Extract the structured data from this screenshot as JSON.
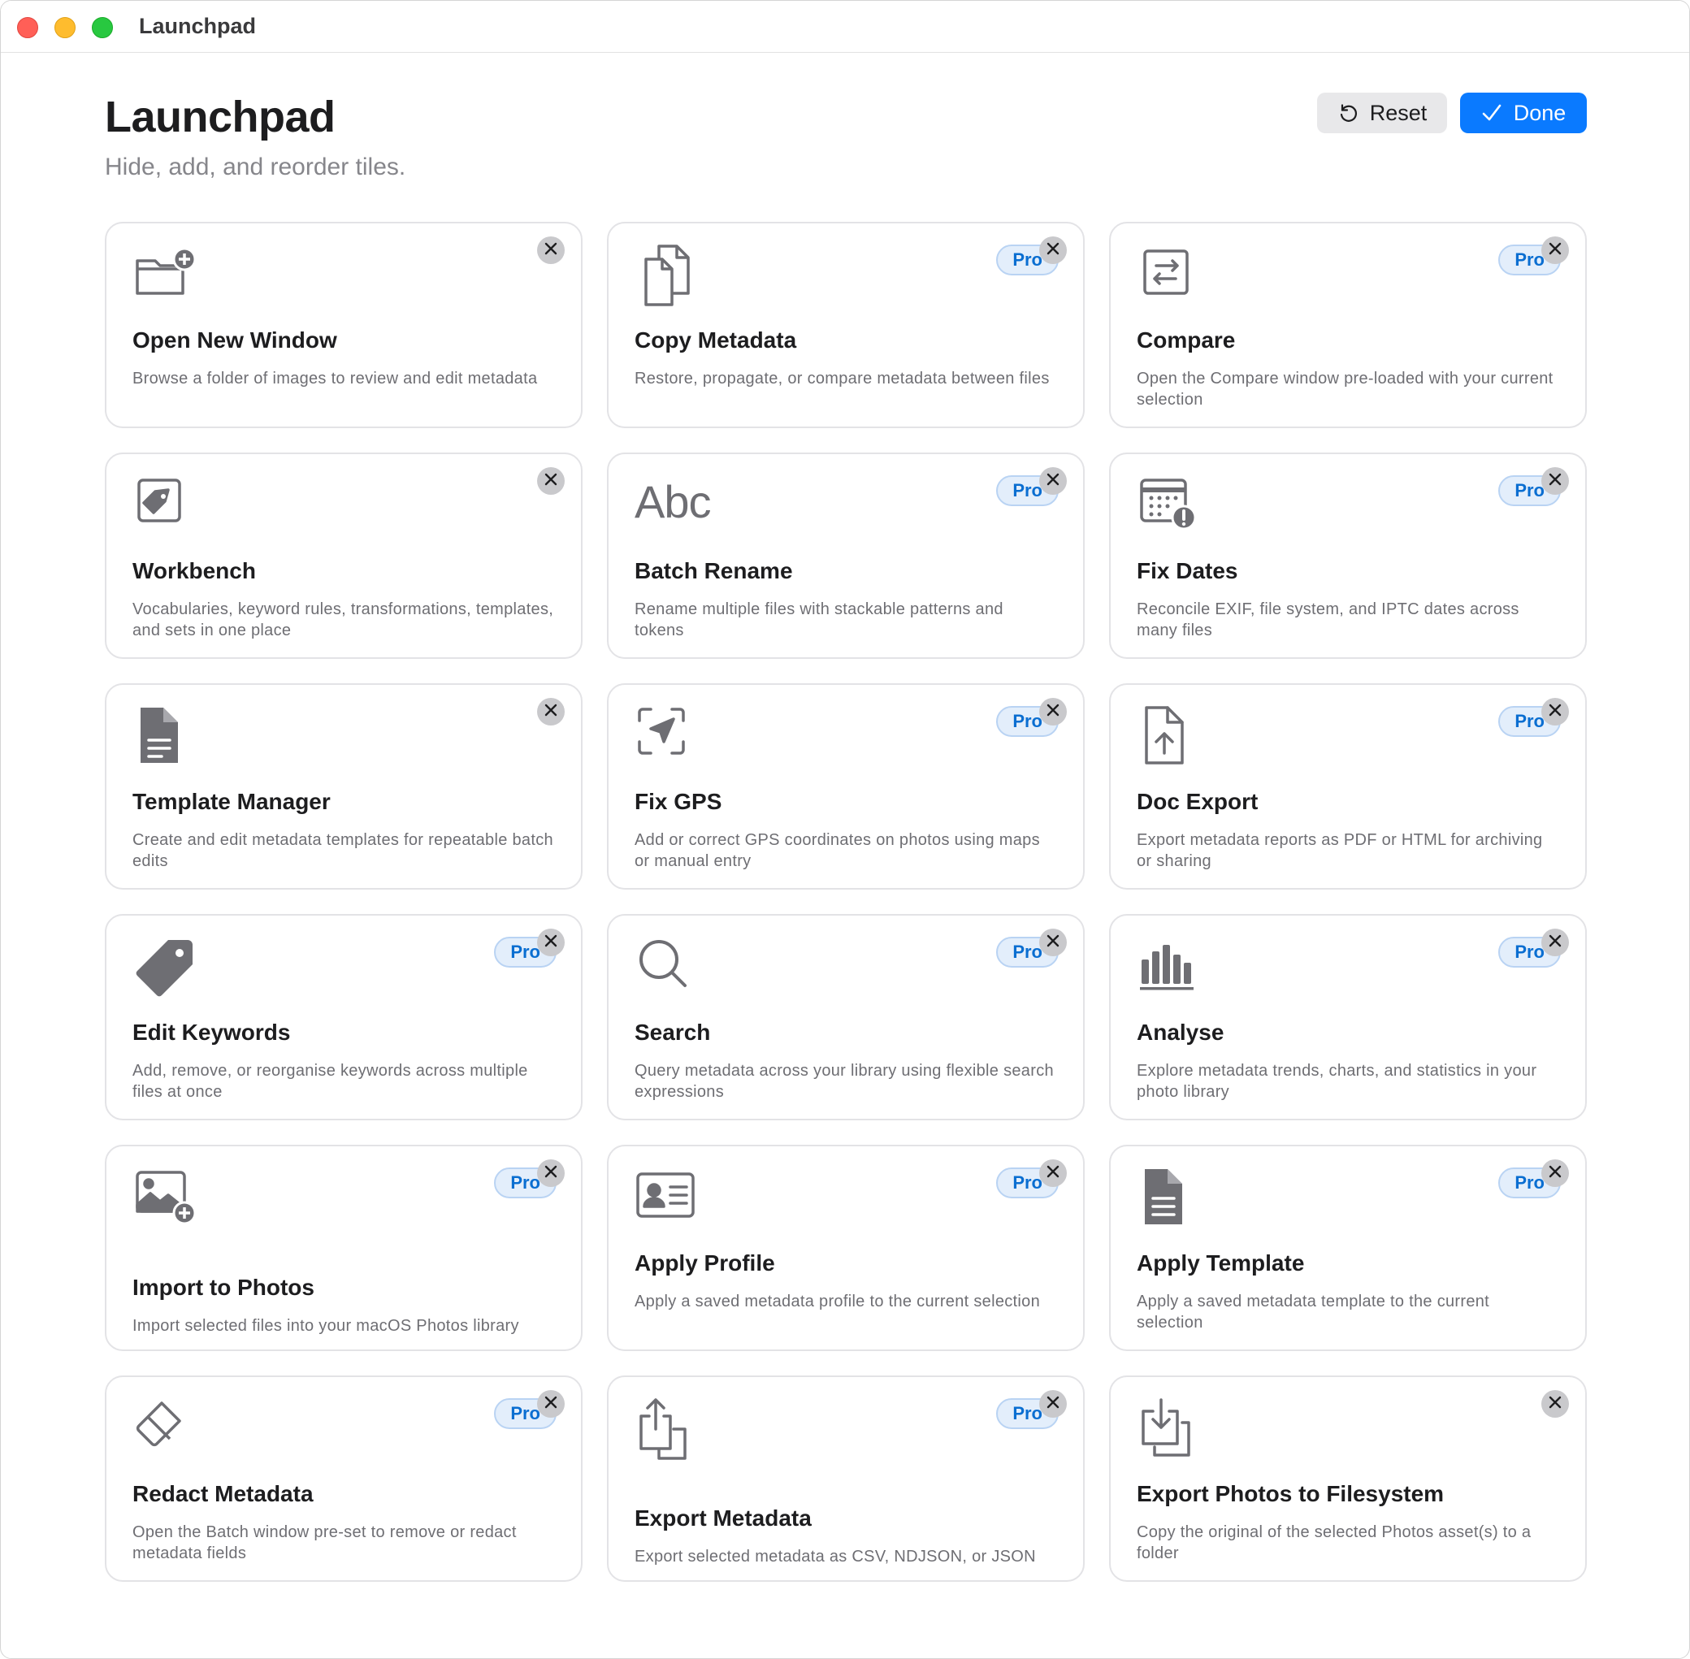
{
  "window": {
    "title": "Launchpad"
  },
  "header": {
    "title": "Launchpad",
    "subtitle": "Hide, add, and reorder tiles.",
    "reset_label": "Reset",
    "done_label": "Done"
  },
  "colors": {
    "accent": "#0a7aff",
    "pro_badge_text": "#0a6ed1",
    "icon": "#6e6e73"
  },
  "tiles": [
    {
      "title": "Open New Window",
      "desc": "Browse a folder of images to review and edit metadata",
      "pro": false,
      "icon": "folder-add-icon"
    },
    {
      "title": "Copy Metadata",
      "desc": "Restore, propagate, or compare metadata between files",
      "pro": true,
      "pro_label": "Pro",
      "icon": "copy-documents-icon"
    },
    {
      "title": "Compare",
      "desc": "Open the Compare window pre-loaded with your current selection",
      "pro": true,
      "pro_label": "Pro",
      "icon": "compare-arrows-icon"
    },
    {
      "title": "Workbench",
      "desc": "Vocabularies, keyword rules, transformations, templates, and sets in one place",
      "pro": false,
      "icon": "tag-square-icon"
    },
    {
      "title": "Batch Rename",
      "desc": "Rename multiple files with stackable patterns and tokens",
      "pro": true,
      "pro_label": "Pro",
      "icon": "abc-text-icon",
      "icon_text": "Abc"
    },
    {
      "title": "Fix Dates",
      "desc": "Reconcile EXIF, file system, and IPTC dates across many files",
      "pro": true,
      "pro_label": "Pro",
      "icon": "calendar-alert-icon"
    },
    {
      "title": "Template Manager",
      "desc": "Create and edit metadata templates for repeatable batch edits",
      "pro": false,
      "icon": "document-icon"
    },
    {
      "title": "Fix GPS",
      "desc": "Add or correct GPS coordinates on photos using maps or manual entry",
      "pro": true,
      "pro_label": "Pro",
      "icon": "location-arrow-icon"
    },
    {
      "title": "Doc Export",
      "desc": "Export metadata reports as PDF or HTML for archiving or sharing",
      "pro": true,
      "pro_label": "Pro",
      "icon": "document-upload-icon"
    },
    {
      "title": "Edit Keywords",
      "desc": "Add, remove, or reorganise keywords across multiple files at once",
      "pro": true,
      "pro_label": "Pro",
      "icon": "tag-icon"
    },
    {
      "title": "Search",
      "desc": "Query metadata across your library using flexible search expressions",
      "pro": true,
      "pro_label": "Pro",
      "icon": "magnifier-icon"
    },
    {
      "title": "Analyse",
      "desc": "Explore metadata trends, charts, and statistics in your photo library",
      "pro": true,
      "pro_label": "Pro",
      "icon": "bar-chart-icon"
    },
    {
      "title": "Import to Photos",
      "desc": "Import selected files into your macOS Photos library",
      "pro": true,
      "pro_label": "Pro",
      "icon": "photo-add-icon"
    },
    {
      "title": "Apply Profile",
      "desc": "Apply a saved metadata profile to the current selection",
      "pro": true,
      "pro_label": "Pro",
      "icon": "id-card-icon"
    },
    {
      "title": "Apply Template",
      "desc": "Apply a saved metadata template to the current selection",
      "pro": true,
      "pro_label": "Pro",
      "icon": "document-lines-icon"
    },
    {
      "title": "Redact Metadata",
      "desc": "Open the Batch window pre-set to remove or redact metadata fields",
      "pro": true,
      "pro_label": "Pro",
      "icon": "eraser-icon"
    },
    {
      "title": "Export Metadata",
      "desc": "Export selected metadata as CSV, NDJSON, or JSON",
      "pro": true,
      "pro_label": "Pro",
      "icon": "share-icon"
    },
    {
      "title": "Export Photos to Filesystem",
      "desc": "Copy the original of the selected Photos asset(s) to a folder",
      "pro": false,
      "icon": "download-copy-icon"
    }
  ]
}
